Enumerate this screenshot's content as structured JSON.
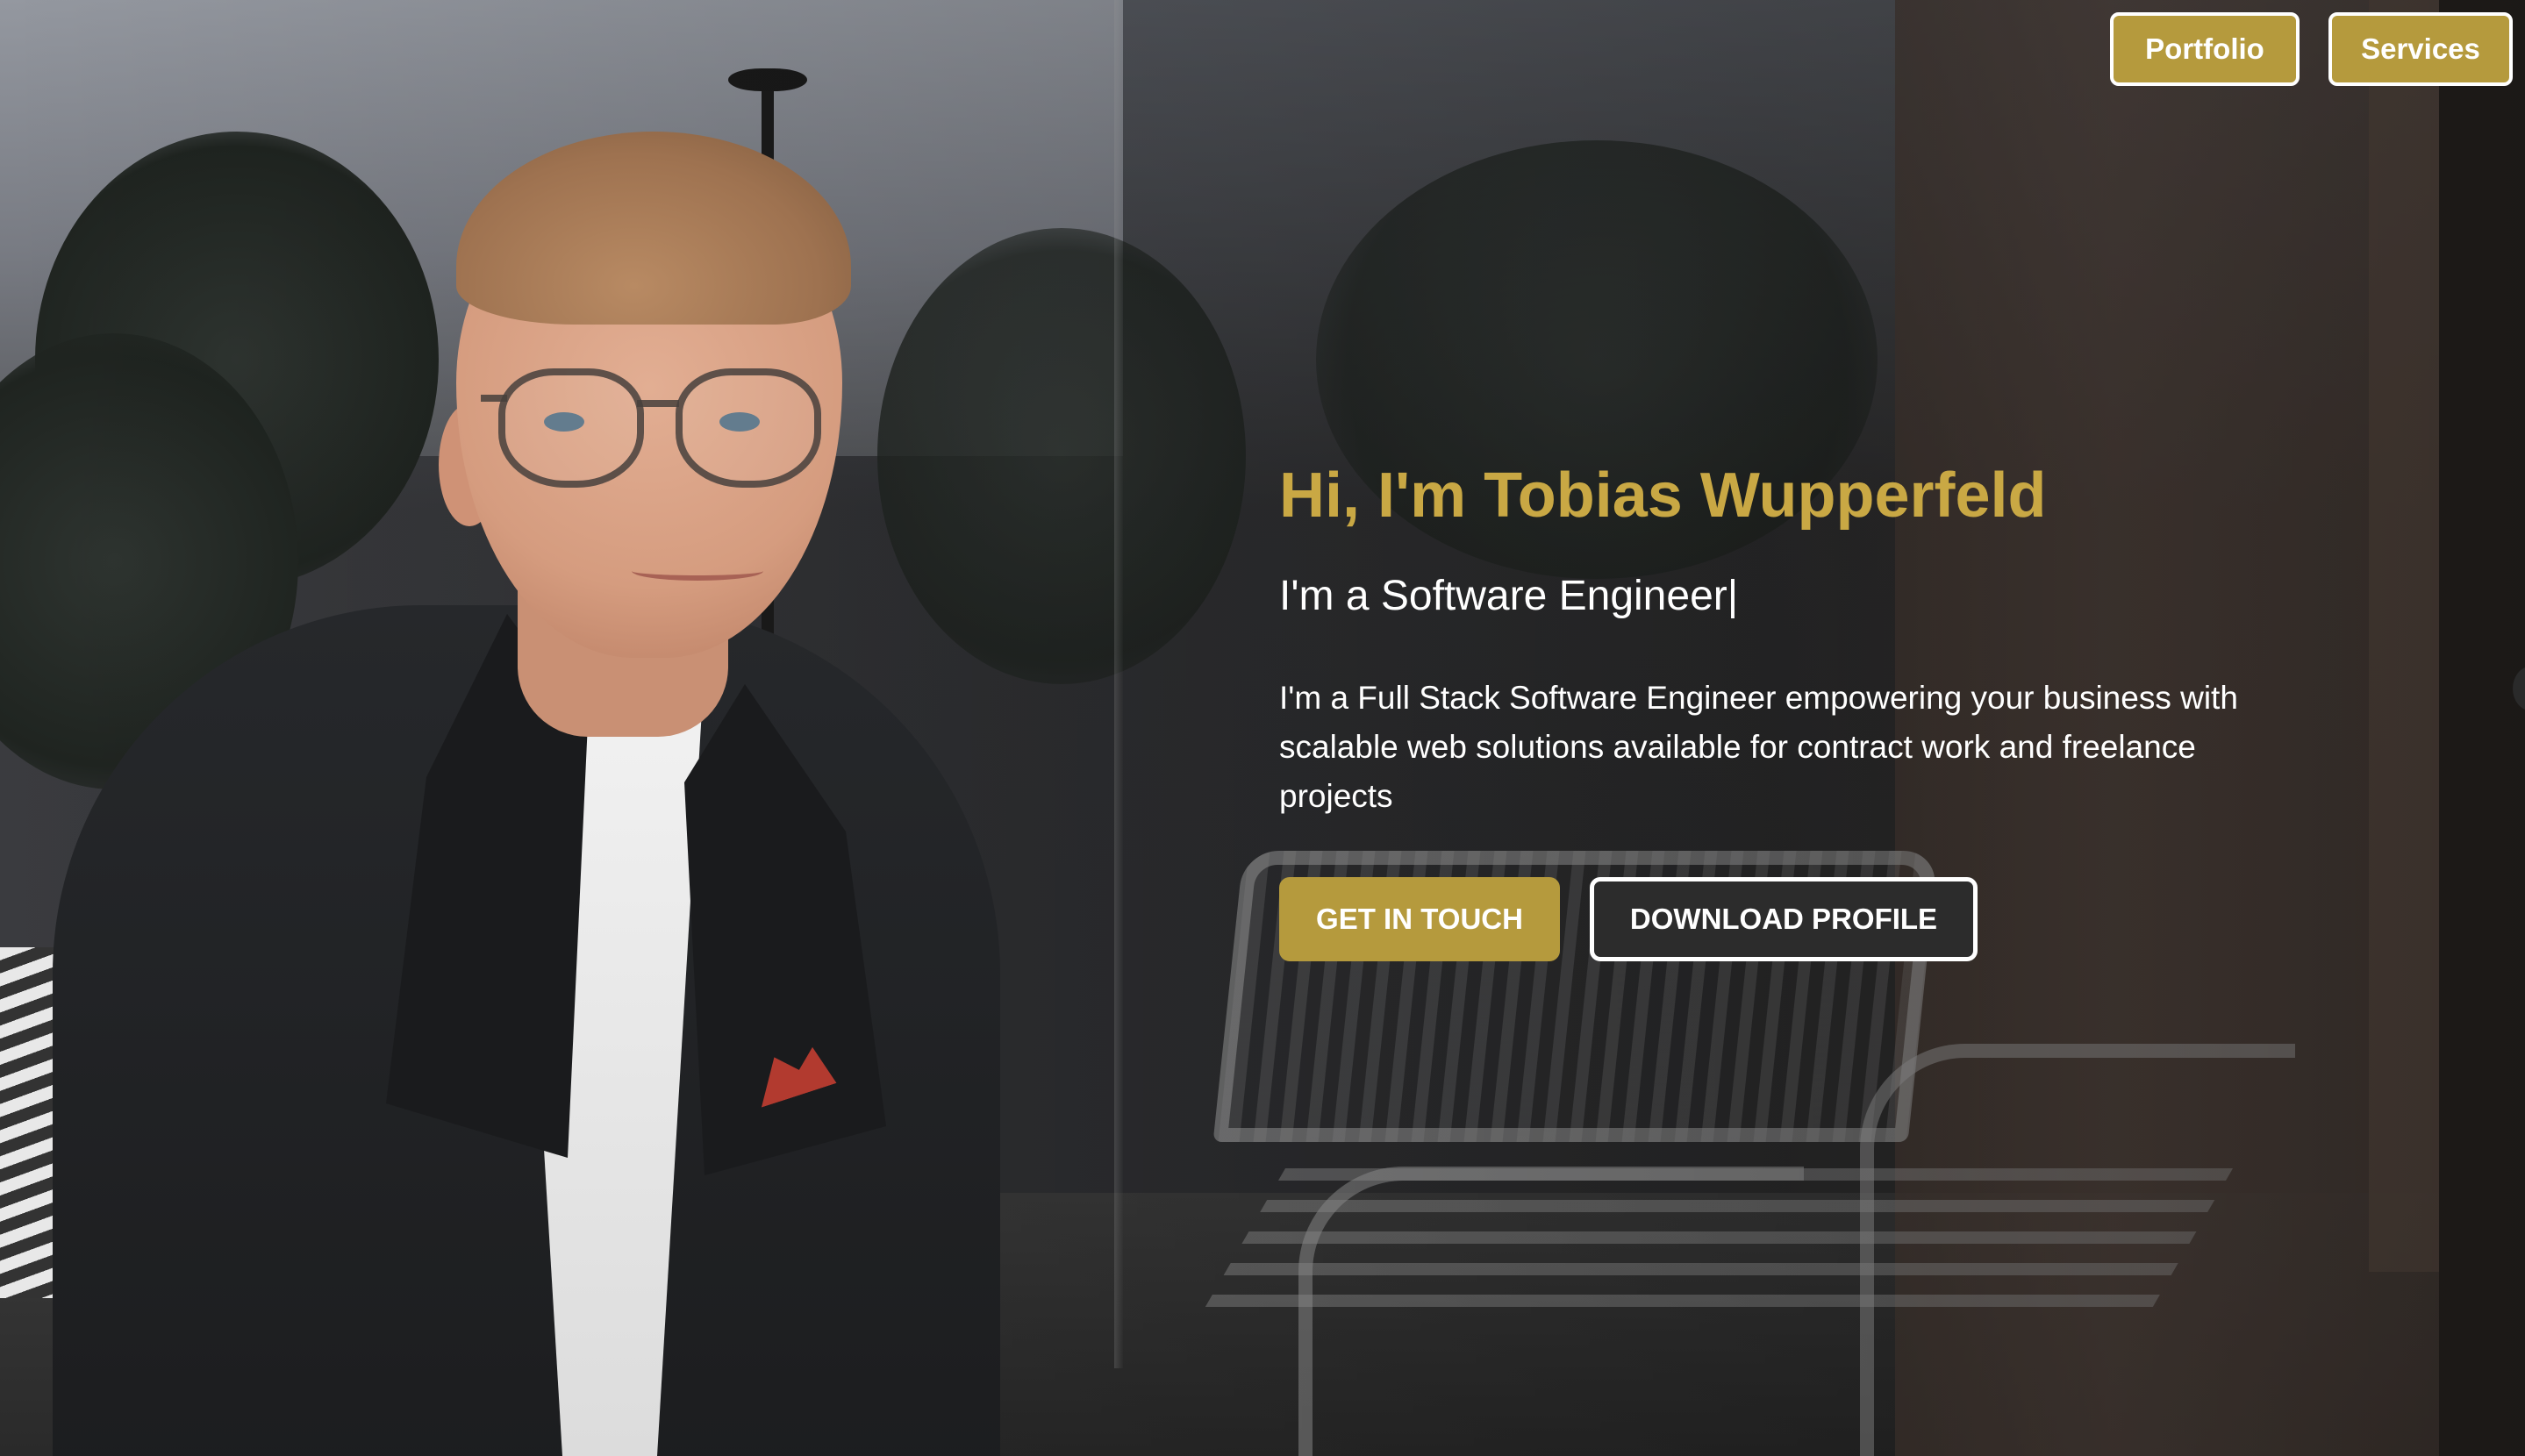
{
  "nav": {
    "portfolio_label": "Portfolio",
    "services_label": "Services"
  },
  "hero": {
    "title": "Hi, I'm Tobias Wupperfeld",
    "subtitle": "I'm a Software Engineer|",
    "description": "I'm a Full Stack Software Engineer empowering your business with scalable web solutions available for contract work and freelance projects",
    "primary_cta": "GET IN TOUCH",
    "secondary_cta": "DOWNLOAD PROFILE"
  },
  "colors": {
    "accent_gold": "#b59a3d",
    "title_gold": "#c9a844",
    "text_white": "#ffffff",
    "background_dark": "#2c2c2c"
  },
  "icons": {
    "background": "portrait-photo"
  }
}
